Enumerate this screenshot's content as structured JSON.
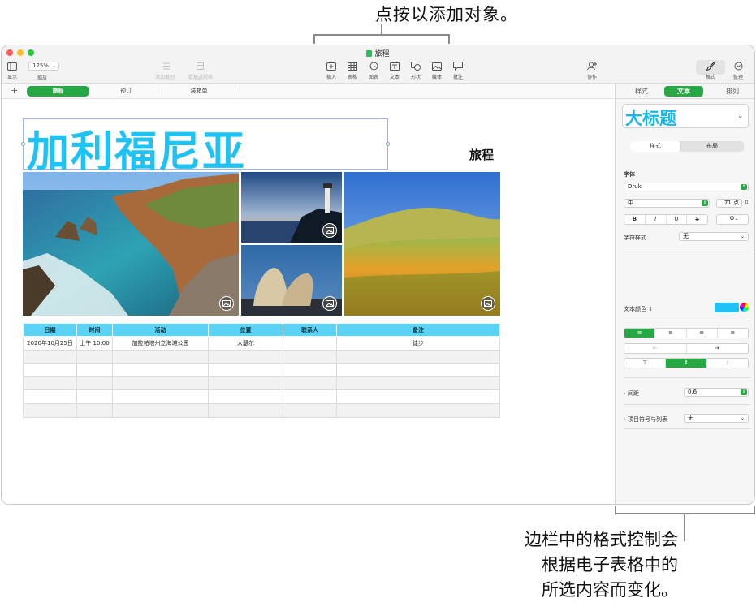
{
  "callouts": {
    "top": "点按以添加对象。",
    "bottom_lines": [
      "边栏中的格式控制会",
      "根据电子表格中的",
      "所选内容而变化。"
    ]
  },
  "window": {
    "title": "旅程"
  },
  "toolbar": {
    "view_label": "显示",
    "zoom_value": "125%",
    "zoom_label": "缩放",
    "add_category_label": "添加类别",
    "pivot_label": "数据透视表",
    "insert_label": "插入",
    "table_label": "表格",
    "chart_label": "图表",
    "text_label": "文本",
    "shape_label": "形状",
    "media_label": "媒体",
    "comment_label": "批注",
    "collaborate_label": "协作",
    "format_label": "格式",
    "organize_label": "整理"
  },
  "sheet_tabs": [
    "旅程",
    "预订",
    "装箱单"
  ],
  "canvas": {
    "big_title": "加利福尼亚",
    "trip_label": "旅程"
  },
  "table": {
    "headers": [
      "日期",
      "时间",
      "活动",
      "位置",
      "联系人",
      "备注"
    ],
    "rows": [
      [
        "2020年10月25日",
        "上午 10:00",
        "加拉帕塔州立海滩公园",
        "大瑟尔",
        "",
        "徒步"
      ],
      [
        "",
        "",
        "",
        "",
        "",
        ""
      ],
      [
        "",
        "",
        "",
        "",
        "",
        ""
      ],
      [
        "",
        "",
        "",
        "",
        "",
        ""
      ],
      [
        "",
        "",
        "",
        "",
        "",
        ""
      ],
      [
        "",
        "",
        "",
        "",
        "",
        ""
      ]
    ]
  },
  "sidebar": {
    "tabs": [
      "样式",
      "文本",
      "排列"
    ],
    "active_tab": "文本",
    "paragraph_style": "大标题",
    "style_layout_seg": [
      "样式",
      "布局"
    ],
    "font_section": "字体",
    "font_name": "Druk",
    "font_weight": "中",
    "font_size": "71 点",
    "style_buttons": [
      "B",
      "I",
      "U",
      "S"
    ],
    "char_style_label": "字符样式",
    "char_style_value": "无",
    "text_color_label": "文本颜色",
    "text_color": "#1fc3f3",
    "spacing_label": "间距",
    "spacing_value": "0.6",
    "bullets_label": "项目符号与列表",
    "bullets_value": "无"
  }
}
